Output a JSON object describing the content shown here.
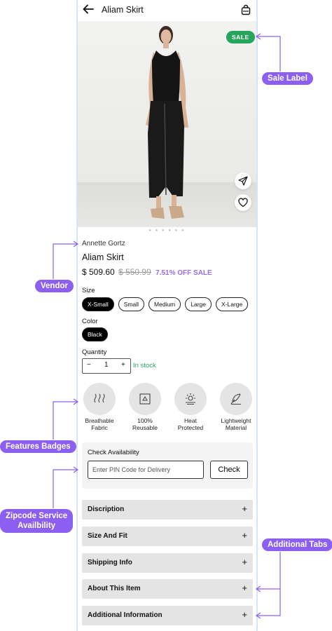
{
  "header": {
    "title": "Aliam Skirt",
    "back_icon": "arrow-left-icon",
    "bag_icon": "shopping-bag-icon"
  },
  "hero": {
    "sale_label": "SALE",
    "share_icon": "send-icon",
    "wishlist_icon": "heart-icon",
    "carousel_dots": "● ● ● ● ● ●"
  },
  "product": {
    "vendor": "Annette Gortz",
    "name": "Aliam Skirt",
    "price": "$ 509.60",
    "original_price": "$ 550.99",
    "discount": "7.51% OFF SALE"
  },
  "size": {
    "label": "Size",
    "options": [
      "X-Small",
      "Small",
      "Medium",
      "Large",
      "X-Large"
    ],
    "selected": "X-Small"
  },
  "color": {
    "label": "Color",
    "options": [
      "Black"
    ],
    "selected": "Black"
  },
  "quantity": {
    "label": "Quantity",
    "minus": "−",
    "value": "1",
    "plus": "+",
    "stock_status": "In stock"
  },
  "features": [
    {
      "line1": "Breathable",
      "line2": "Fabric",
      "icon": "breathable-icon"
    },
    {
      "line1": "100%",
      "line2": "Reusable",
      "icon": "reusable-icon"
    },
    {
      "line1": "Heat",
      "line2": "Protected",
      "icon": "heat-icon"
    },
    {
      "line1": "Lightweight",
      "line2": "Material",
      "icon": "feather-icon"
    }
  ],
  "availability": {
    "title": "Check Availability",
    "placeholder": "Enter PIN Code for Delivery",
    "button": "Check"
  },
  "tabs": [
    {
      "label": "Discription",
      "icon": "+"
    },
    {
      "label": "Size And Fit",
      "icon": "+"
    },
    {
      "label": "Shipping Info",
      "icon": "+"
    },
    {
      "label": "About This Item",
      "icon": "+"
    },
    {
      "label": "Additional Information",
      "icon": "+"
    }
  ],
  "annotations": {
    "sale_label": "Sale Label",
    "vendor": "Vendor",
    "features": "Features Badges",
    "zipcode_1": "Zipcode Service",
    "zipcode_2": "Availbility",
    "tabs": "Additional Tabs"
  },
  "colors": {
    "accent": "#8c5ff0",
    "sale_green": "#28a55d",
    "discount_purple": "#9b6ce4"
  }
}
